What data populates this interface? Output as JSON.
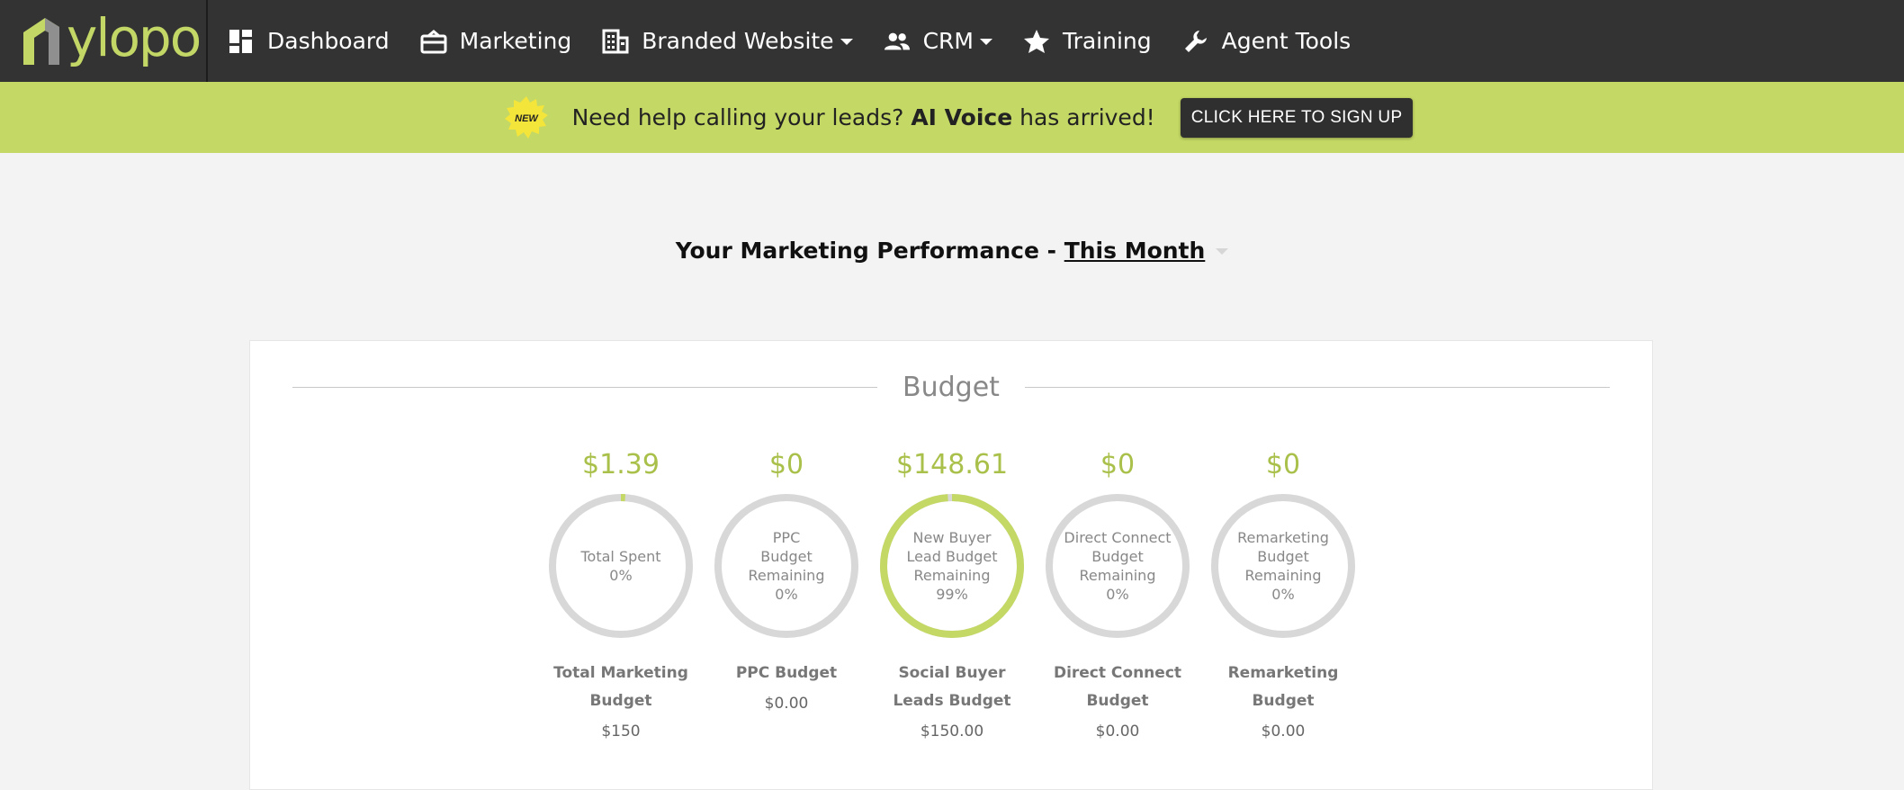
{
  "brand": {
    "name": "ylopo",
    "accent_color": "#c4d865",
    "logo_color": "#c2d766"
  },
  "nav": {
    "items": [
      {
        "label": "Dashboard",
        "icon": "dashboard-icon",
        "dropdown": false
      },
      {
        "label": "Marketing",
        "icon": "marketing-icon",
        "dropdown": false
      },
      {
        "label": "Branded Website",
        "icon": "building-icon",
        "dropdown": true
      },
      {
        "label": "CRM",
        "icon": "people-icon",
        "dropdown": true
      },
      {
        "label": "Training",
        "icon": "star-icon",
        "dropdown": false
      },
      {
        "label": "Agent Tools",
        "icon": "wrench-icon",
        "dropdown": false
      }
    ]
  },
  "banner": {
    "badge": "NEW",
    "text_before": "Need help calling your leads? ",
    "text_bold": "AI Voice",
    "text_after": " has arrived!",
    "button_label": "CLICK HERE TO SIGN UP"
  },
  "performance": {
    "title_prefix": "Your Marketing Performance - ",
    "period": "This Month"
  },
  "budget": {
    "section_title": "Budget",
    "metrics": [
      {
        "amount": "$1.39",
        "ring_label": [
          "Total Spent",
          "0%"
        ],
        "percent": 1,
        "name": [
          "Total Marketing",
          "Budget"
        ],
        "value": "$150"
      },
      {
        "amount": "$0",
        "ring_label": [
          "PPC",
          "Budget",
          "Remaining",
          "0%"
        ],
        "percent": 0,
        "name": [
          "PPC Budget"
        ],
        "value": "$0.00"
      },
      {
        "amount": "$148.61",
        "ring_label": [
          "New Buyer",
          "Lead Budget",
          "Remaining",
          "99%"
        ],
        "percent": 99,
        "name": [
          "Social Buyer",
          "Leads Budget"
        ],
        "value": "$150.00"
      },
      {
        "amount": "$0",
        "ring_label": [
          "Direct Connect",
          "Budget",
          "Remaining",
          "0%"
        ],
        "percent": 0,
        "name": [
          "Direct Connect",
          "Budget"
        ],
        "value": "$0.00"
      },
      {
        "amount": "$0",
        "ring_label": [
          "Remarketing",
          "Budget",
          "Remaining",
          "0%"
        ],
        "percent": 0,
        "name": [
          "Remarketing",
          "Budget"
        ],
        "value": "$0.00"
      }
    ],
    "ring_track_color": "#d8d8d8",
    "ring_fill_color": "#c4d865"
  }
}
